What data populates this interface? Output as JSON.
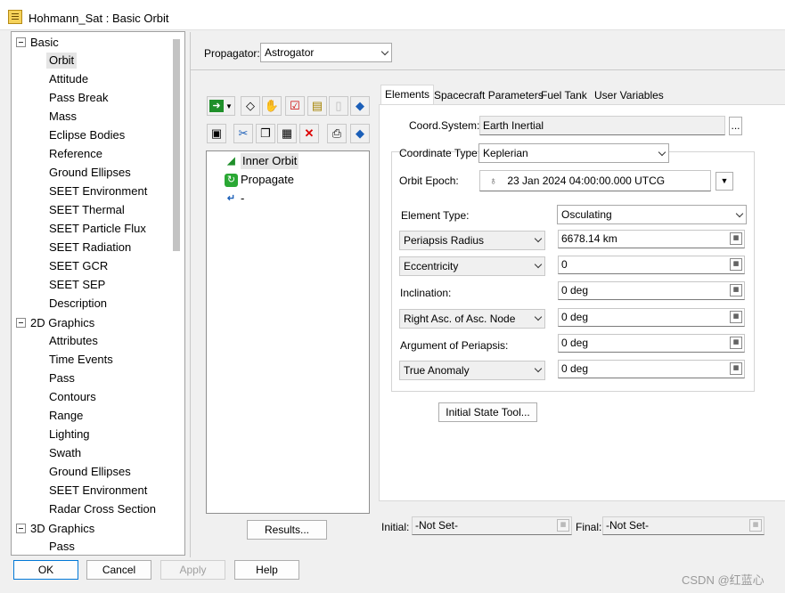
{
  "window": {
    "title": "Hohmann_Sat : Basic Orbit",
    "icon": "document-properties-icon"
  },
  "tree": {
    "groups": [
      {
        "label": "Basic",
        "expanded": true,
        "items": [
          "Orbit",
          "Attitude",
          "Pass Break",
          "Mass",
          "Eclipse Bodies",
          "Reference",
          "Ground Ellipses",
          "SEET Environment",
          "SEET Thermal",
          "SEET Particle Flux",
          "SEET Radiation",
          "SEET GCR",
          "SEET SEP",
          "Description"
        ]
      },
      {
        "label": "2D Graphics",
        "expanded": true,
        "items": [
          "Attributes",
          "Time Events",
          "Pass",
          "Contours",
          "Range",
          "Lighting",
          "Swath",
          "Ground Ellipses",
          "SEET Environment",
          "Radar Cross Section"
        ]
      },
      {
        "label": "3D Graphics",
        "expanded": true,
        "items": [
          "Pass"
        ]
      }
    ],
    "selected": "Orbit"
  },
  "propagator": {
    "label": "Propagator:",
    "value": "Astrogator"
  },
  "sequence": {
    "items": [
      {
        "label": "Inner Orbit",
        "icon": "target-sequence-icon"
      },
      {
        "label": "Propagate",
        "icon": "propagate-icon"
      },
      {
        "label": "-",
        "icon": "return-arrow-icon"
      }
    ],
    "results_button": "Results..."
  },
  "tabs": [
    "Elements",
    "Spacecraft Parameters",
    "Fuel Tank",
    "User Variables"
  ],
  "active_tab": "Elements",
  "elements": {
    "coord_system_label": "Coord.System:",
    "coord_system_value": "Earth Inertial",
    "coord_system_button": "...",
    "coord_type_label": "Coordinate Type:",
    "coord_type_value": "Keplerian",
    "orbit_epoch_label": "Orbit Epoch:",
    "orbit_epoch_value": "23 Jan 2024 04:00:00.000 UTCG",
    "element_type_label": "Element Type:",
    "element_type_value": "Osculating",
    "rows": [
      {
        "label": "Periapsis Radius",
        "selectable": true,
        "value": "6678.14 km"
      },
      {
        "label": "Eccentricity",
        "selectable": true,
        "value": "0"
      },
      {
        "label": "Inclination:",
        "selectable": false,
        "value": "0 deg"
      },
      {
        "label": "Right Asc. of Asc. Node",
        "selectable": true,
        "value": "0 deg"
      },
      {
        "label": "Argument of Periapsis:",
        "selectable": false,
        "value": "0 deg"
      },
      {
        "label": "True Anomaly",
        "selectable": true,
        "value": "0 deg"
      }
    ],
    "initial_state_button": "Initial State Tool..."
  },
  "footer": {
    "initial_label": "Initial:",
    "initial_value": "-Not Set-",
    "final_label": "Final:",
    "final_value": "-Not Set-"
  },
  "buttons": {
    "ok": "OK",
    "cancel": "Cancel",
    "apply": "Apply",
    "help": "Help"
  },
  "watermark": "CSDN @红蓝心"
}
